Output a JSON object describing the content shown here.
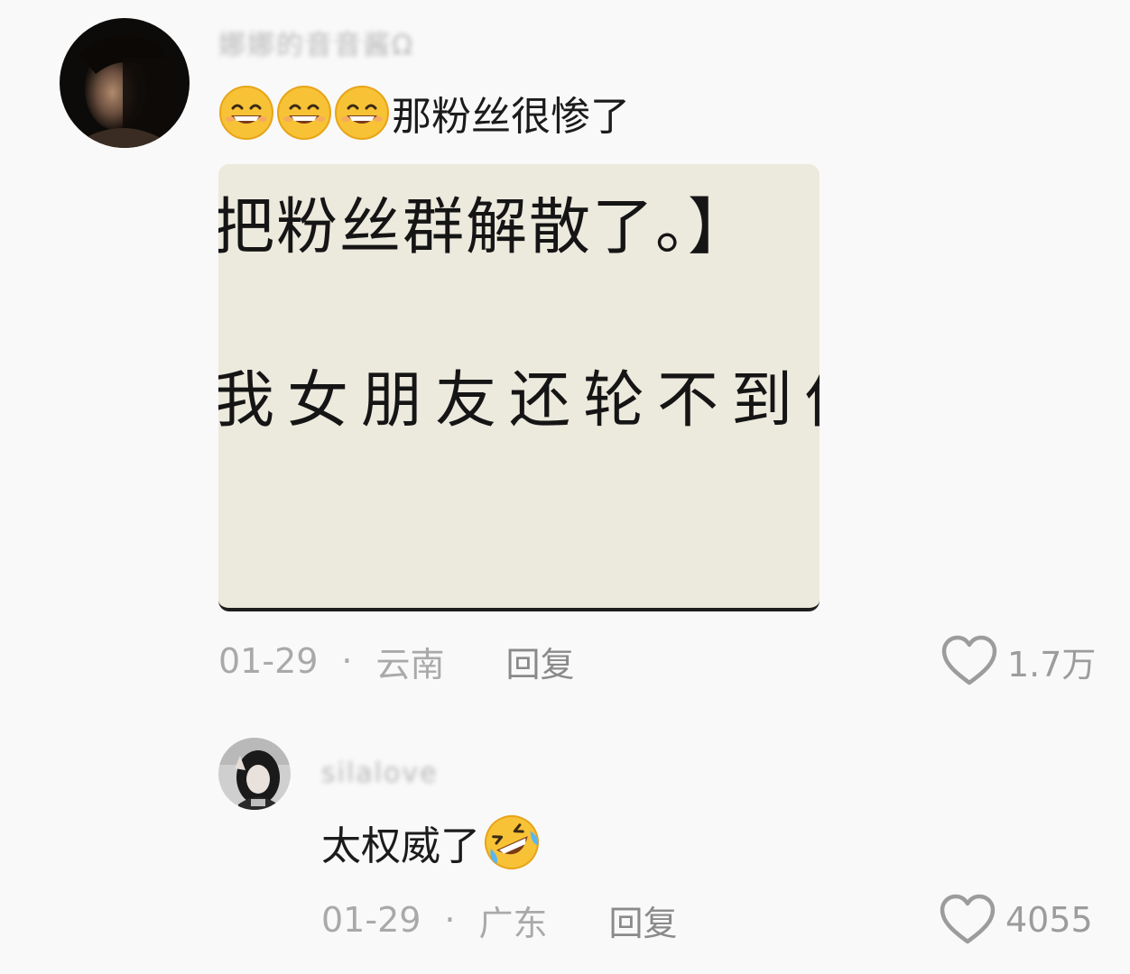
{
  "comments": [
    {
      "username": "娜娜的音音酱Ω",
      "text": "那粉丝很惨了",
      "emoji_prefix": [
        "grinning-emoji",
        "grinning-emoji",
        "grinning-emoji"
      ],
      "attached_image": {
        "line1": "把粉丝群解散了。】",
        "line2": "我女朋友还轮不到他"
      },
      "date": "01-29",
      "separator": "·",
      "location": "云南",
      "reply_label": "回复",
      "likes": "1.7万"
    },
    {
      "username": "silalove",
      "text": "太权威了",
      "emoji_suffix": [
        "rolling-on-floor-laughing-emoji"
      ],
      "date": "01-29",
      "separator": "·",
      "location": "广东",
      "reply_label": "回复",
      "likes": "4055"
    }
  ],
  "colors": {
    "background": "#f9f9f9",
    "meta_text": "#a9a9a9",
    "image_background": "#ece9dd",
    "emoji_yellow": "#f7c236"
  }
}
